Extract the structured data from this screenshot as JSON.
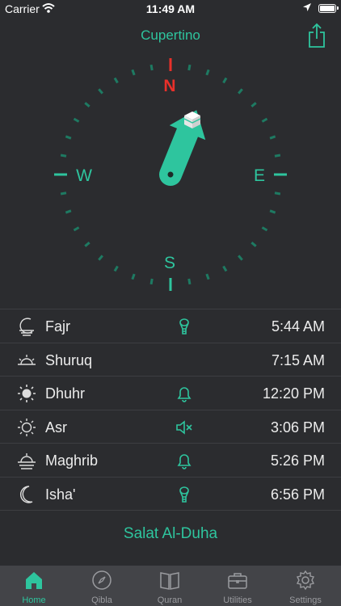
{
  "status_bar": {
    "carrier": "Carrier",
    "time": "11:49 AM"
  },
  "header": {
    "title": "Cupertino"
  },
  "compass": {
    "north": "N",
    "south": "S",
    "east": "E",
    "west": "W"
  },
  "prayers": [
    {
      "name": "Fajr",
      "time": "5:44 AM",
      "alert": "adhan-mic-icon"
    },
    {
      "name": "Shuruq",
      "time": "7:15 AM",
      "alert": "none"
    },
    {
      "name": "Dhuhr",
      "time": "12:20 PM",
      "alert": "bell-icon"
    },
    {
      "name": "Asr",
      "time": "3:06 PM",
      "alert": "muted-speaker-icon"
    },
    {
      "name": "Maghrib",
      "time": "5:26 PM",
      "alert": "bell-icon"
    },
    {
      "name": "Isha'",
      "time": "6:56 PM",
      "alert": "adhan-mic-icon"
    }
  ],
  "extra": {
    "duha_label": "Salat Al-Duha"
  },
  "tabs": [
    {
      "label": "Home",
      "icon": "mosque-icon",
      "active": true
    },
    {
      "label": "Qibla",
      "icon": "compass-icon",
      "active": false
    },
    {
      "label": "Quran",
      "icon": "book-icon",
      "active": false
    },
    {
      "label": "Utilities",
      "icon": "briefcase-icon",
      "active": false
    },
    {
      "label": "Settings",
      "icon": "gear-icon",
      "active": false
    }
  ],
  "colors": {
    "accent": "#2ec59e",
    "north": "#e8302a",
    "background": "#2b2c2f",
    "tab_bar": "#434448",
    "tick": "#1e7a62"
  }
}
